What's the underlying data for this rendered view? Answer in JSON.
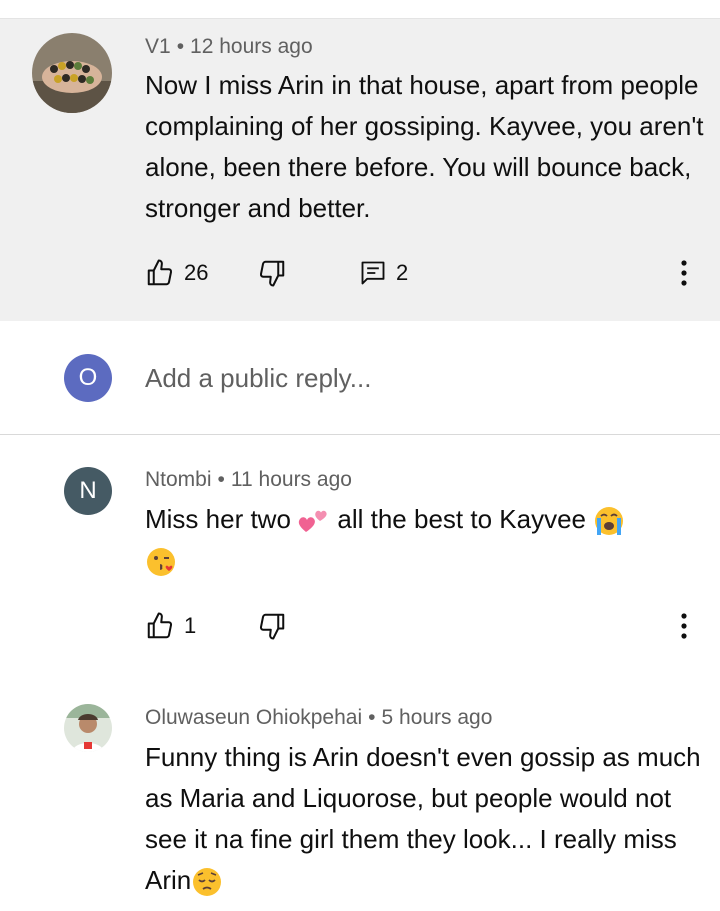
{
  "colors": {
    "highlight_bg": "#f0f0f0",
    "reply_avatar": "#5c6bc0",
    "n_avatar": "#455a64"
  },
  "comments": [
    {
      "author": "V1",
      "time": "12 hours ago",
      "text": "Now I miss Arin in that house, apart from people complaining of her gossiping. Kayvee, you aren't alone, been there before. You will bounce back, stronger and better.",
      "likes": "26",
      "replies": "2",
      "avatar_icon": "bracelet-photo"
    },
    {
      "author": "Ntombi",
      "time": "11 hours ago",
      "text_a": "Miss her two",
      "text_b": "all the best to Kayvee",
      "emojis": [
        "two-hearts",
        "loudly-crying-face",
        "face-blowing-kiss"
      ],
      "likes": "1",
      "avatar_letter": "N"
    },
    {
      "author": "Oluwaseun Ohiokpehai",
      "time": "5 hours ago",
      "text_a": "Funny thing is Arin doesn't even gossip as much as Maria and Liquorose, but people would not see it na fine girl them they look... I really miss Arin",
      "emojis": [
        "pensive-face"
      ],
      "avatar_icon": "person-photo"
    }
  ],
  "reply_box": {
    "avatar_letter": "O",
    "placeholder": "Add a public reply..."
  },
  "separator": "•"
}
